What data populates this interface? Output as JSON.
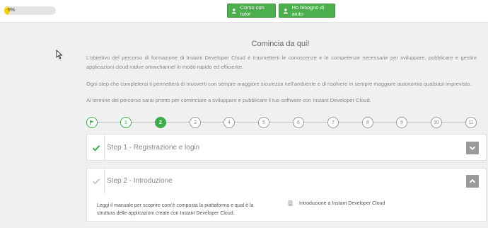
{
  "header": {
    "progress_label": "9%",
    "progress_fraction": 0.09,
    "buttons": {
      "tutor": "Corso con tutor",
      "help": "Ho bisogno di aiuto"
    }
  },
  "intro": {
    "title": "Comincia da qui!",
    "paragraphs": [
      "L’obiettivo del percorso di formazione di Instant Developer Cloud è trasmetterti le conoscenze e le competenze necessarie per sviluppare, pubblicare e gestire applicazioni cloud native omnichannel in modo rapido ed efficiente.",
      "Ogni step che completerai ti permetterà di muoverti con sempre maggiore sicurezza nell’ambiente e di risolvere in sempre maggiore autonomia qualsiasi imprevisto.",
      "Al termine del percorso sarai pronto per cominciare a sviluppare e pubblicare il tuo software con Instant Developer Cloud."
    ]
  },
  "steps": [
    "1",
    "2",
    "3",
    "4",
    "5",
    "6",
    "7",
    "8",
    "9",
    "10",
    "11"
  ],
  "current_step": "2",
  "panels": [
    {
      "title": "Step 1 - Registrazione e login"
    },
    {
      "title": "Step 2 - Introduzione",
      "description": "Leggi il manuale per scoprire com’è composta la piattaforma e qual è la struttura delle applicazioni create con Instant Developer Cloud.",
      "link": "Introduzione a Instant Developer Cloud"
    }
  ],
  "colors": {
    "accent_green": "#3cae4a",
    "button_green": "#4cae4c",
    "progress_yellow": "#f2d500",
    "toggle_gray": "#9a9a9a"
  }
}
